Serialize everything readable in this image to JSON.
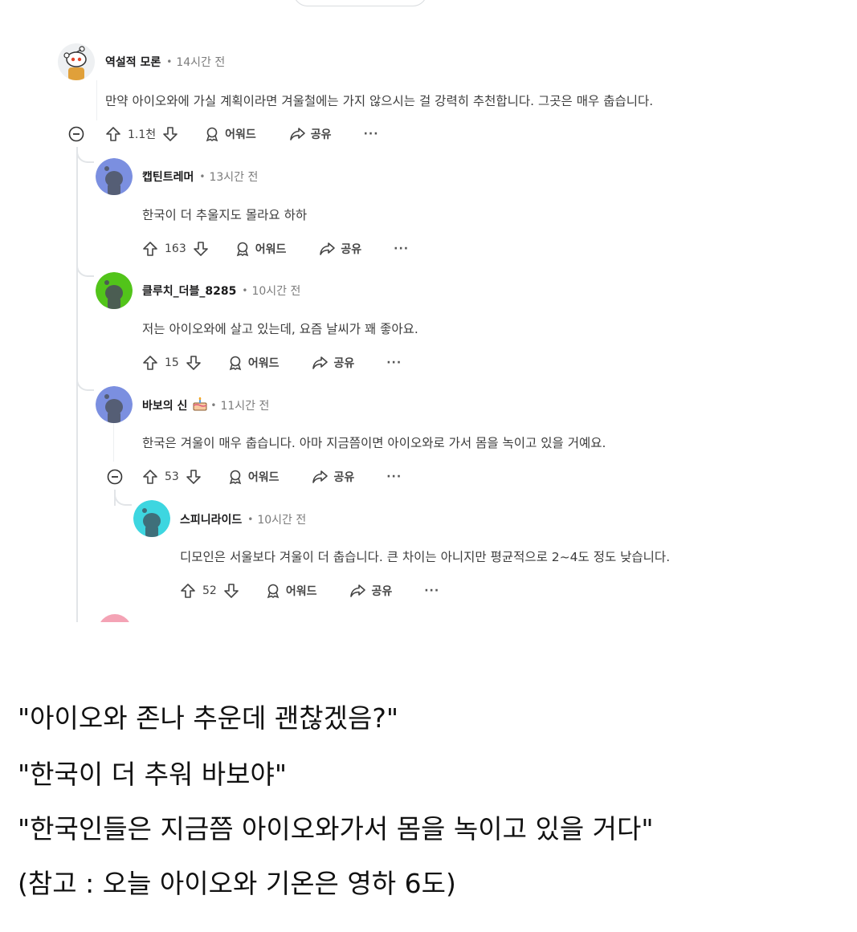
{
  "comments": [
    {
      "author": "역설적 모론",
      "time": "14시간 전",
      "flair": "",
      "body": "만약 아이오와에 가실 계획이라면 겨울철에는 가지 않으시는 걸 강력히 추천합니다. 그곳은 매우 춥습니다.",
      "votes": "1.1천",
      "avatar_color": "#ffffff",
      "avatar_icon": "snoo-avatar"
    },
    {
      "author": "캡틴트레머",
      "time": "13시간 전",
      "flair": "",
      "body": "한국이 더 추울지도 몰라요 하하",
      "votes": "163",
      "avatar_color": "#7b8fe0",
      "avatar_icon": "snoo-avatar"
    },
    {
      "author": "클루치_더블_8285",
      "time": "10시간 전",
      "flair": "",
      "body": "저는 아이오와에 살고 있는데, 요즘 날씨가 꽤 좋아요.",
      "votes": "15",
      "avatar_color": "#52c41a",
      "avatar_icon": "snoo-avatar"
    },
    {
      "author": "바보의 신",
      "time": "11시간 전",
      "flair": "cake-icon",
      "body": "한국은 겨울이 매우 춥습니다. 아마 지금쯤이면 아이오와로 가서 몸을 녹이고 있을 거예요.",
      "votes": "53",
      "avatar_color": "#7b8fe0",
      "avatar_icon": "snoo-avatar"
    },
    {
      "author": "스피니라이드",
      "time": "10시간 전",
      "flair": "",
      "body": "디모인은 서울보다 겨울이 더 춥습니다. 큰 차이는 아니지만 평균적으로 2~4도 정도 낮습니다.",
      "votes": "52",
      "avatar_color": "#3dd6e0",
      "avatar_icon": "snoo-avatar"
    }
  ],
  "actions": {
    "award_label": "어워드",
    "share_label": "공유",
    "more_label": "···"
  },
  "caption": [
    "\"아이오와 존나 추운데 괜찮겠음?\"",
    "\"한국이 더 추워 바보야\"",
    "\"한국인들은 지금쯤 아이오와가서 몸을 녹이고 있을 거다\"",
    "(참고 : 오늘 아이오와 기온은 영하 6도)"
  ],
  "colors": {
    "thread_line": "#e2e5e8",
    "meta_gray": "#7c7c7c",
    "body_text": "#3c3c3c"
  }
}
